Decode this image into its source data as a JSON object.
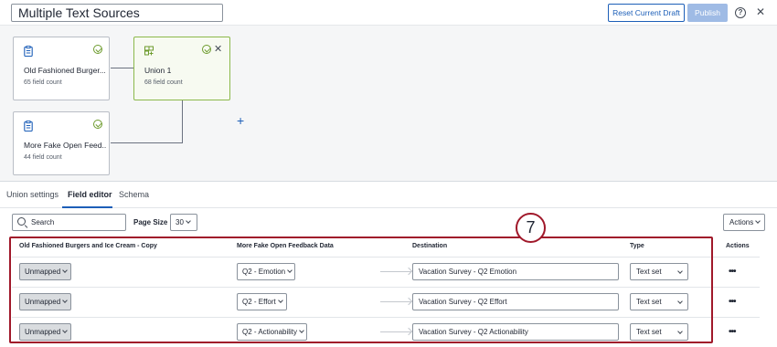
{
  "header": {
    "title": "Multiple Text Sources",
    "reset_label": "Reset Current Draft",
    "publish_label": "Publish",
    "help_icon": "?",
    "close_icon": "✕"
  },
  "canvas": {
    "nodes": [
      {
        "name": "Old Fashioned Burger...",
        "count": "65 field count",
        "icon": "survey-icon"
      },
      {
        "name": "Union 1",
        "count": "68 field count",
        "icon": "union-icon"
      },
      {
        "name": "More Fake Open Feed...",
        "count": "44 field count",
        "icon": "survey-icon"
      }
    ],
    "add_label": "+"
  },
  "tabs": [
    {
      "label": "Union settings"
    },
    {
      "label": "Field editor"
    },
    {
      "label": "Schema"
    }
  ],
  "toolbar": {
    "search_placeholder": "Search",
    "page_size_label": "Page Size",
    "page_size_value": "30",
    "actions_label": "Actions"
  },
  "table": {
    "headers": [
      "Old Fashioned Burgers and Ice Cream - Copy",
      "More Fake Open Feedback Data",
      "Destination",
      "Type",
      "Actions"
    ],
    "rows": [
      {
        "source1": "Unmapped",
        "source2": "Q2 - Emotion",
        "destination": "Vacation Survey - Q2 Emotion",
        "type": "Text set"
      },
      {
        "source1": "Unmapped",
        "source2": "Q2 - Effort",
        "destination": "Vacation Survey - Q2 Effort",
        "type": "Text set"
      },
      {
        "source1": "Unmapped",
        "source2": "Q2 - Actionability",
        "destination": "Vacation Survey - Q2 Actionability",
        "type": "Text set"
      }
    ],
    "more_label": "•••"
  },
  "annotation": {
    "number": "7",
    "color": "#a0182a"
  }
}
